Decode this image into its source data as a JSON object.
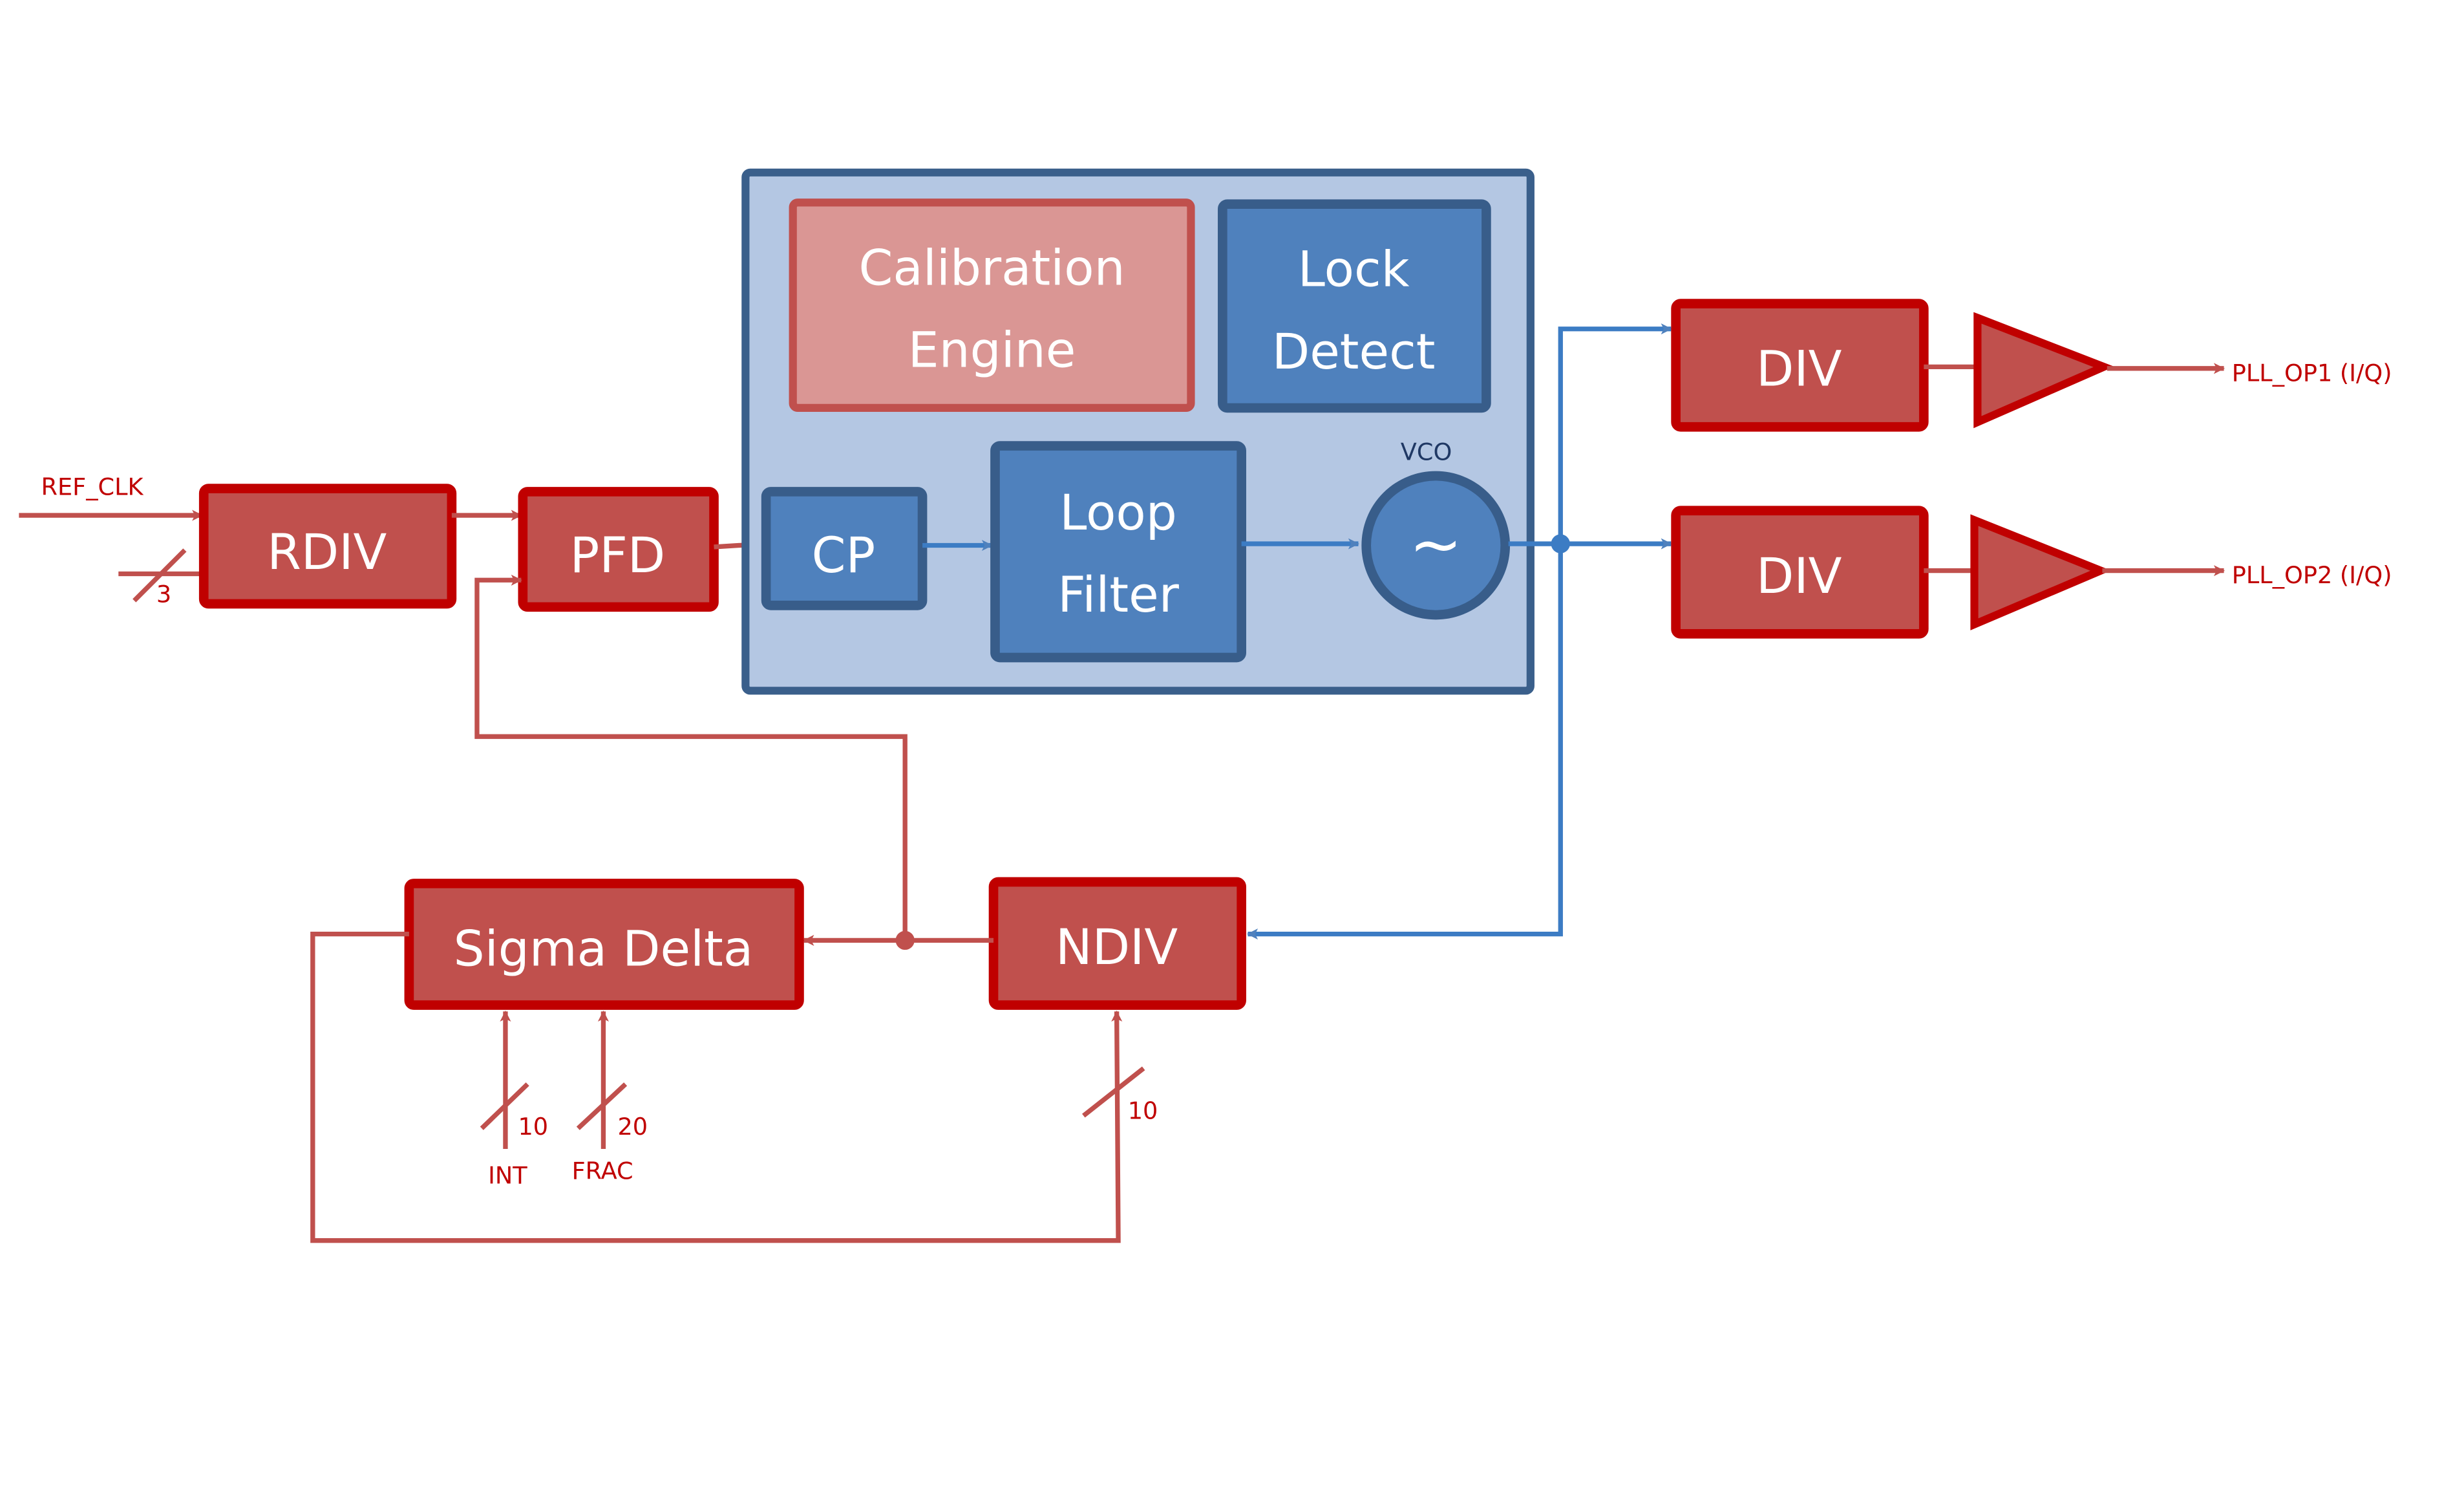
{
  "colors": {
    "red_border": "#C00000",
    "red_fill": "#C0504D",
    "pink_fill": "#DA9694",
    "blue_container_fill": "#B4C7E3",
    "blue_border": "#3A5F8B",
    "blue_fill": "#4F81BD",
    "red_wire": "#C0504D",
    "blue_wire": "#4F81BD",
    "label_red": "#C00000",
    "label_blue": "#1F3864"
  },
  "inputs": {
    "ref_clk": "REF_CLK",
    "rdiv_bus_width": "3",
    "int_label": "INT",
    "int_bus_width": "10",
    "frac_label": "FRAC",
    "frac_bus_width": "20",
    "ndiv_bus_width": "10"
  },
  "blocks": {
    "rdiv": "RDIV",
    "pfd": "PFD",
    "cp": "CP",
    "calibration_line1": "Calibration",
    "calibration_line2": "Engine",
    "lock_line1": "Lock",
    "lock_line2": "Detect",
    "loop_line1": "Loop",
    "loop_line2": "Filter",
    "vco_label": "VCO",
    "vco_symbol": "~",
    "div1": "DIV",
    "div2": "DIV",
    "ndiv": "NDIV",
    "sigma_delta": "Sigma Delta"
  },
  "outputs": {
    "op1": "PLL_OP1 (I/Q)",
    "op2": "PLL_OP2 (I/Q)"
  }
}
